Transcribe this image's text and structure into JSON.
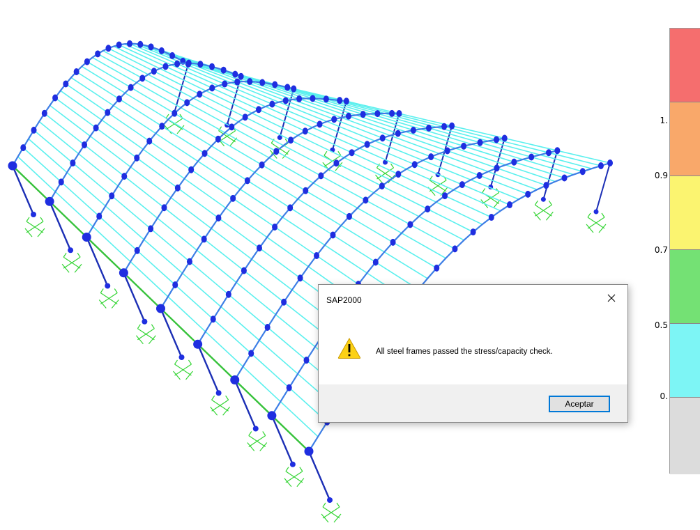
{
  "legend": {
    "labels": [
      "1.",
      "0.9",
      "0.7",
      "0.5",
      "0."
    ],
    "colors": [
      "#f56e6e",
      "#f9a86a",
      "#fbf470",
      "#74e174",
      "#7df5f5",
      "#dcdcdc"
    ]
  },
  "model": {
    "rafter_color": "#3d7ee6",
    "purlin_color": "#5bf0ee",
    "column_color": "#1c2fb5",
    "eave_beam_color": "#37c23b",
    "support_color": "#35d535",
    "hinge_color": "#1f2ee0"
  },
  "dialog": {
    "title": "SAP2000",
    "message": "All steel frames passed the stress/capacity check.",
    "ok_label": "Aceptar",
    "icon": "warning-icon",
    "close_icon": "close-icon"
  }
}
